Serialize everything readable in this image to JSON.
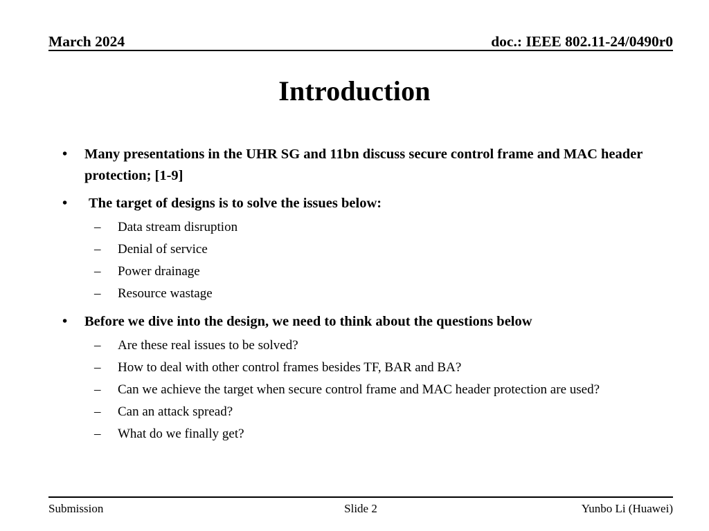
{
  "header": {
    "date": "March 2024",
    "doc": "doc.: IEEE 802.11-24/0490r0"
  },
  "title": "Introduction",
  "bullet_marker": "•",
  "dash_marker": "–",
  "content": {
    "items": [
      {
        "level": 1,
        "text": "Many presentations in the UHR SG and 11bn discuss secure control frame and MAC header protection; [1-9]"
      },
      {
        "level": 1,
        "text": "The target of designs is to solve the issues below:"
      },
      {
        "level": 2,
        "text": "Data stream disruption"
      },
      {
        "level": 2,
        "text": "Denial of service"
      },
      {
        "level": 2,
        "text": "Power drainage"
      },
      {
        "level": 2,
        "text": "Resource wastage"
      },
      {
        "level": 1,
        "text": "Before we dive into the design, we need to think about the questions below"
      },
      {
        "level": 2,
        "text": "Are these real issues to be solved?"
      },
      {
        "level": 2,
        "text": "How to deal with other control frames besides TF, BAR and BA?"
      },
      {
        "level": 2,
        "text": "Can we achieve the target when secure control frame and MAC header protection are used?"
      },
      {
        "level": 2,
        "text": "Can an attack spread?"
      },
      {
        "level": 2,
        "text": "What do we finally get?"
      }
    ]
  },
  "footer": {
    "left": "Submission",
    "center": "Slide 2",
    "right": "Yunbo Li (Huawei)"
  }
}
